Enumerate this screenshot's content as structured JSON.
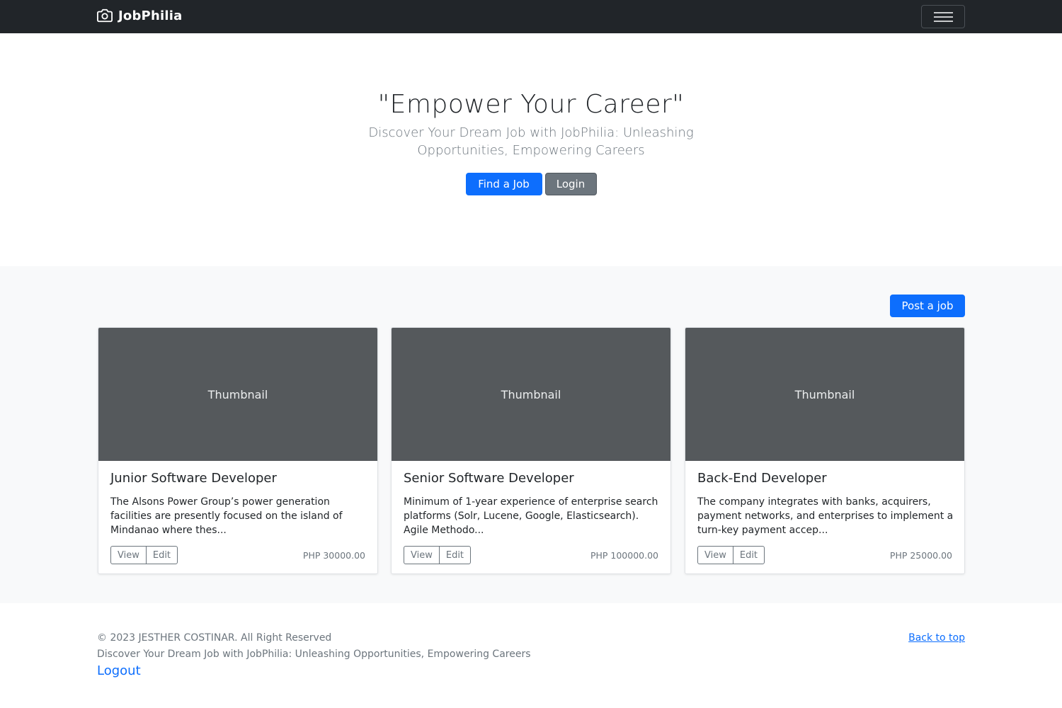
{
  "navbar": {
    "brand": "JobPhilia",
    "brand_icon": "camera-icon",
    "menu_icon": "hamburger-menu-icon"
  },
  "hero": {
    "title": "\"Empower Your Career\"",
    "lead": "Discover Your Dream Job with JobPhilia: Unleashing Opportunities, Empowering Careers",
    "find_label": "Find a Job",
    "login_label": "Login"
  },
  "album": {
    "post_label": "Post a job",
    "cards": [
      {
        "thumbnail": "Thumbnail",
        "title": "Junior Software Developer",
        "text": "The Alsons Power Group’s power generation facilities are presently focused on the island of Mindanao where thes...",
        "view": "View",
        "edit": "Edit",
        "price": "PHP 30000.00"
      },
      {
        "thumbnail": "Thumbnail",
        "title": "Senior Software Developer",
        "text": "Minimum of 1-year experience of enterprise search platforms (Solr, Lucene, Google, Elasticsearch). Agile Methodo...",
        "view": "View",
        "edit": "Edit",
        "price": "PHP 100000.00"
      },
      {
        "thumbnail": "Thumbnail",
        "title": "Back-End Developer",
        "text": "The company integrates with banks, acquirers, payment networks, and enterprises to implement a turn-key payment accep...",
        "view": "View",
        "edit": "Edit",
        "price": "PHP 25000.00"
      }
    ]
  },
  "footer": {
    "copyright": "© 2023 JESTHER COSTINAR. All Right Reserved",
    "tagline": "Discover Your Dream Job with JobPhilia: Unleashing Opportunities, Empowering Careers",
    "logout": "Logout",
    "back_to_top": "Back to top"
  },
  "colors": {
    "navbar": "#212529",
    "primary": "#0d6efd",
    "secondary": "#6c757d",
    "thumbnail": "#55595c",
    "album_bg": "#f8f9fa"
  }
}
